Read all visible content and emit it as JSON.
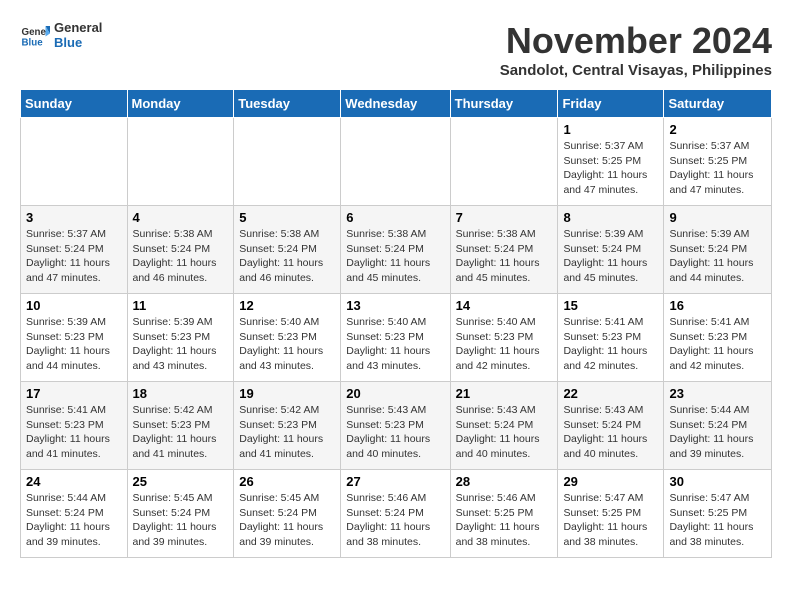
{
  "logo": {
    "text_general": "General",
    "text_blue": "Blue"
  },
  "title": "November 2024",
  "subtitle": "Sandolot, Central Visayas, Philippines",
  "days_of_week": [
    "Sunday",
    "Monday",
    "Tuesday",
    "Wednesday",
    "Thursday",
    "Friday",
    "Saturday"
  ],
  "weeks": [
    {
      "days": [
        {
          "num": "",
          "info": ""
        },
        {
          "num": "",
          "info": ""
        },
        {
          "num": "",
          "info": ""
        },
        {
          "num": "",
          "info": ""
        },
        {
          "num": "",
          "info": ""
        },
        {
          "num": "1",
          "info": "Sunrise: 5:37 AM\nSunset: 5:25 PM\nDaylight: 11 hours\nand 47 minutes."
        },
        {
          "num": "2",
          "info": "Sunrise: 5:37 AM\nSunset: 5:25 PM\nDaylight: 11 hours\nand 47 minutes."
        }
      ]
    },
    {
      "days": [
        {
          "num": "3",
          "info": "Sunrise: 5:37 AM\nSunset: 5:24 PM\nDaylight: 11 hours\nand 47 minutes."
        },
        {
          "num": "4",
          "info": "Sunrise: 5:38 AM\nSunset: 5:24 PM\nDaylight: 11 hours\nand 46 minutes."
        },
        {
          "num": "5",
          "info": "Sunrise: 5:38 AM\nSunset: 5:24 PM\nDaylight: 11 hours\nand 46 minutes."
        },
        {
          "num": "6",
          "info": "Sunrise: 5:38 AM\nSunset: 5:24 PM\nDaylight: 11 hours\nand 45 minutes."
        },
        {
          "num": "7",
          "info": "Sunrise: 5:38 AM\nSunset: 5:24 PM\nDaylight: 11 hours\nand 45 minutes."
        },
        {
          "num": "8",
          "info": "Sunrise: 5:39 AM\nSunset: 5:24 PM\nDaylight: 11 hours\nand 45 minutes."
        },
        {
          "num": "9",
          "info": "Sunrise: 5:39 AM\nSunset: 5:24 PM\nDaylight: 11 hours\nand 44 minutes."
        }
      ]
    },
    {
      "days": [
        {
          "num": "10",
          "info": "Sunrise: 5:39 AM\nSunset: 5:23 PM\nDaylight: 11 hours\nand 44 minutes."
        },
        {
          "num": "11",
          "info": "Sunrise: 5:39 AM\nSunset: 5:23 PM\nDaylight: 11 hours\nand 43 minutes."
        },
        {
          "num": "12",
          "info": "Sunrise: 5:40 AM\nSunset: 5:23 PM\nDaylight: 11 hours\nand 43 minutes."
        },
        {
          "num": "13",
          "info": "Sunrise: 5:40 AM\nSunset: 5:23 PM\nDaylight: 11 hours\nand 43 minutes."
        },
        {
          "num": "14",
          "info": "Sunrise: 5:40 AM\nSunset: 5:23 PM\nDaylight: 11 hours\nand 42 minutes."
        },
        {
          "num": "15",
          "info": "Sunrise: 5:41 AM\nSunset: 5:23 PM\nDaylight: 11 hours\nand 42 minutes."
        },
        {
          "num": "16",
          "info": "Sunrise: 5:41 AM\nSunset: 5:23 PM\nDaylight: 11 hours\nand 42 minutes."
        }
      ]
    },
    {
      "days": [
        {
          "num": "17",
          "info": "Sunrise: 5:41 AM\nSunset: 5:23 PM\nDaylight: 11 hours\nand 41 minutes."
        },
        {
          "num": "18",
          "info": "Sunrise: 5:42 AM\nSunset: 5:23 PM\nDaylight: 11 hours\nand 41 minutes."
        },
        {
          "num": "19",
          "info": "Sunrise: 5:42 AM\nSunset: 5:23 PM\nDaylight: 11 hours\nand 41 minutes."
        },
        {
          "num": "20",
          "info": "Sunrise: 5:43 AM\nSunset: 5:23 PM\nDaylight: 11 hours\nand 40 minutes."
        },
        {
          "num": "21",
          "info": "Sunrise: 5:43 AM\nSunset: 5:24 PM\nDaylight: 11 hours\nand 40 minutes."
        },
        {
          "num": "22",
          "info": "Sunrise: 5:43 AM\nSunset: 5:24 PM\nDaylight: 11 hours\nand 40 minutes."
        },
        {
          "num": "23",
          "info": "Sunrise: 5:44 AM\nSunset: 5:24 PM\nDaylight: 11 hours\nand 39 minutes."
        }
      ]
    },
    {
      "days": [
        {
          "num": "24",
          "info": "Sunrise: 5:44 AM\nSunset: 5:24 PM\nDaylight: 11 hours\nand 39 minutes."
        },
        {
          "num": "25",
          "info": "Sunrise: 5:45 AM\nSunset: 5:24 PM\nDaylight: 11 hours\nand 39 minutes."
        },
        {
          "num": "26",
          "info": "Sunrise: 5:45 AM\nSunset: 5:24 PM\nDaylight: 11 hours\nand 39 minutes."
        },
        {
          "num": "27",
          "info": "Sunrise: 5:46 AM\nSunset: 5:24 PM\nDaylight: 11 hours\nand 38 minutes."
        },
        {
          "num": "28",
          "info": "Sunrise: 5:46 AM\nSunset: 5:25 PM\nDaylight: 11 hours\nand 38 minutes."
        },
        {
          "num": "29",
          "info": "Sunrise: 5:47 AM\nSunset: 5:25 PM\nDaylight: 11 hours\nand 38 minutes."
        },
        {
          "num": "30",
          "info": "Sunrise: 5:47 AM\nSunset: 5:25 PM\nDaylight: 11 hours\nand 38 minutes."
        }
      ]
    }
  ]
}
